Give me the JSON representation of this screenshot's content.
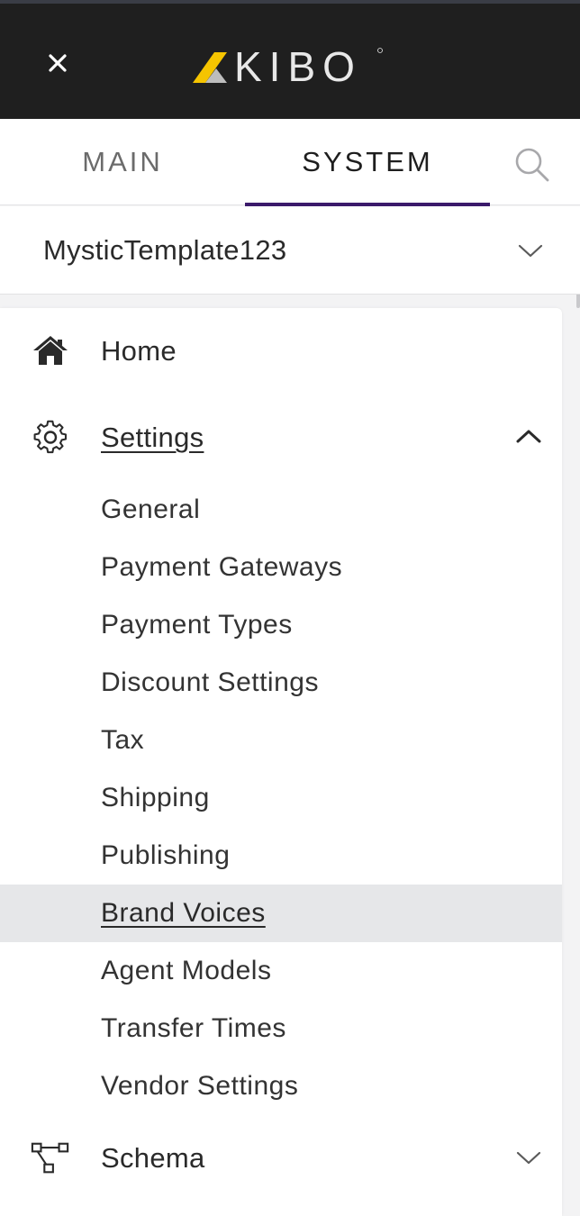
{
  "header": {
    "close_icon": "close-icon",
    "logo_text": "KIBO",
    "brand_colors": {
      "background": "#1f1f1f",
      "logo_yellow": "#f5c400",
      "logo_text": "#e8e8e8"
    }
  },
  "tabs": [
    {
      "label": "MAIN",
      "active": false
    },
    {
      "label": "SYSTEM",
      "active": true
    }
  ],
  "tab_indicator_color": "#3b1a6b",
  "search_icon": "search-icon",
  "tenant_selector": {
    "value": "MysticTemplate123",
    "icon": "chevron-down-icon"
  },
  "nav": {
    "home": {
      "label": "Home",
      "icon": "home-icon"
    },
    "settings": {
      "label": "Settings",
      "icon": "gear-icon",
      "expanded": true,
      "toggle_icon": "chevron-up-icon",
      "items": [
        {
          "label": "General"
        },
        {
          "label": "Payment Gateways"
        },
        {
          "label": "Payment Types"
        },
        {
          "label": "Discount Settings"
        },
        {
          "label": "Tax"
        },
        {
          "label": "Shipping"
        },
        {
          "label": "Publishing"
        },
        {
          "label": "Brand Voices",
          "active": true
        },
        {
          "label": "Agent Models"
        },
        {
          "label": "Transfer Times"
        },
        {
          "label": "Vendor Settings"
        }
      ]
    },
    "schema": {
      "label": "Schema",
      "icon": "schema-icon",
      "toggle_icon": "chevron-down-icon"
    }
  },
  "colors": {
    "active_row_bg": "#e6e7e9",
    "panel_bg": "#ffffff",
    "page_bg": "#f3f3f4"
  }
}
